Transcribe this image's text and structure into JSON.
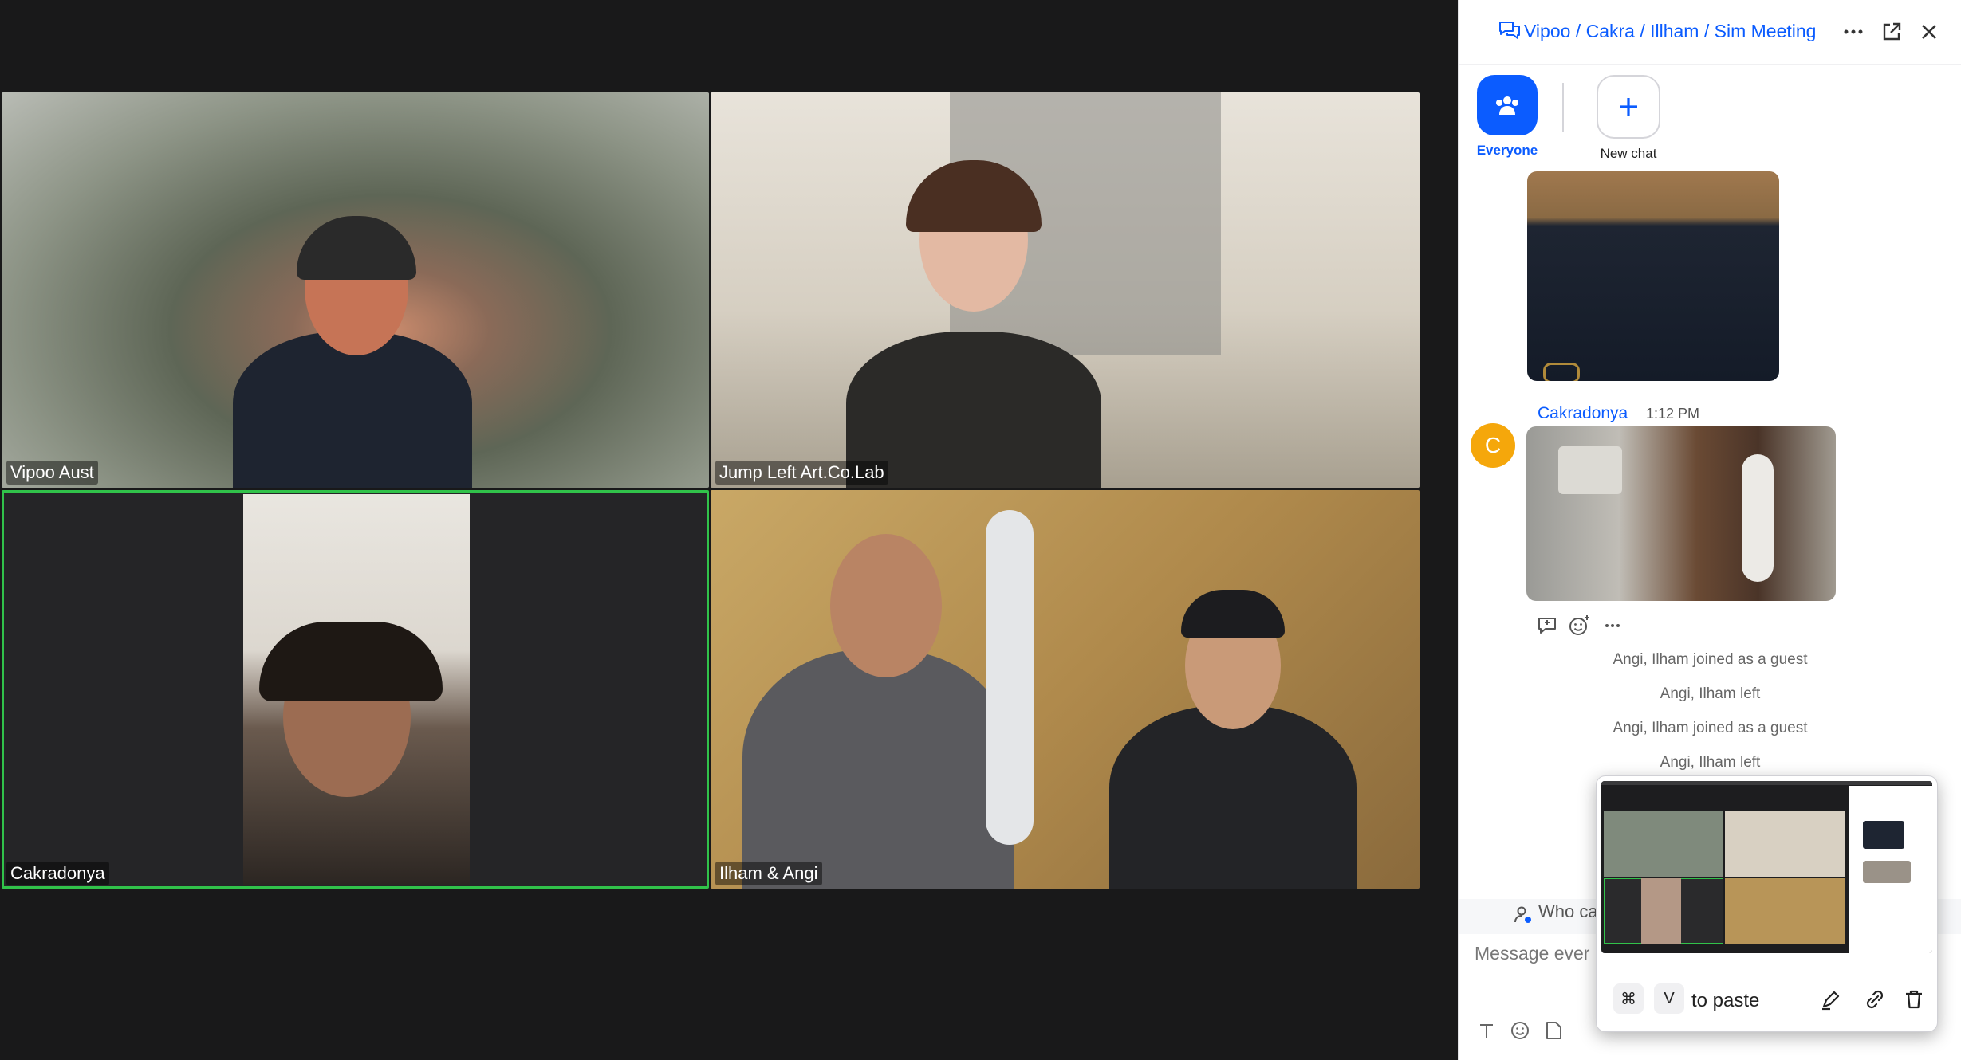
{
  "meeting": {
    "participants": [
      {
        "name": "Vipoo Aust",
        "active_speaker": false
      },
      {
        "name": "Jump Left Art.Co.Lab",
        "active_speaker": false
      },
      {
        "name": "Cakradonya",
        "active_speaker": true
      },
      {
        "name": "Ilham & Angi",
        "active_speaker": false
      }
    ]
  },
  "chat": {
    "title": "Vipoo / Cakra / Illham / Sim Meeting",
    "header_icons": [
      "more-icon",
      "popout-icon",
      "close-icon"
    ],
    "recipients": [
      {
        "label": "Everyone",
        "icon": "everyone-icon",
        "selected": true
      },
      {
        "label": "New chat",
        "icon": "plus-icon",
        "selected": false
      }
    ],
    "message": {
      "avatar_letter": "C",
      "sender": "Cakradonya",
      "time": "1:12 PM"
    },
    "system_messages": [
      "Angi, Ilham joined as a guest",
      "Angi, Ilham left",
      "Angi, Ilham joined as a guest",
      "Angi, Ilham left"
    ],
    "who_can_see": "Who ca",
    "input_placeholder": "Message ever"
  },
  "paste_popup": {
    "key1": "⌘",
    "key2": "V",
    "hint": "to paste"
  },
  "colors": {
    "accent": "#0b5cff",
    "speaker_border": "#31c24a",
    "avatar": "#f5a70b",
    "background": "#19191a"
  }
}
